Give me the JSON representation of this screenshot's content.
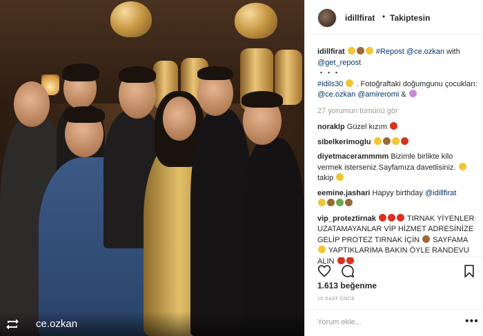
{
  "photo": {
    "repost_user": "ce.ozkan",
    "alt": "Group photo at a birthday party with gold balloons"
  },
  "header": {
    "username": "idillfirat",
    "separator": "•",
    "follow_label": "Takiptesin"
  },
  "caption": {
    "user": "idillfirat",
    "text_1": "#Repost",
    "mention_1": "@ce.ozkan",
    "text_2": "with",
    "mention_2": "@get_repost",
    "dots": "・・・",
    "hashtag": "#idils30",
    "text_3": ". Fotoğraftaki doğumgunu çocukları:",
    "mention_3": "@ce.ozkan",
    "mention_4": "@amireromi",
    "amp": "&"
  },
  "more_comments_label": "27 yorumun tümünü gör",
  "comments": [
    {
      "user": "noraklp",
      "text": "Güzel kızım"
    },
    {
      "user": "sibelkerimoglu",
      "text": ""
    },
    {
      "user": "diyetmacerammmm",
      "text": "Bizimle birlikte kilo vermek isterseniz.Sayfamıza davetlisiniz.",
      "tail": "takip"
    },
    {
      "user": "eemine.jashari",
      "text": "Hapyy birthday",
      "mention": "@idillfirat"
    },
    {
      "user": "vip_proteztirnak",
      "text": "TIRNAK YİYENLER UZATAMAYANLAR VİP HİZMET ADRESİNİZE GELİP PROTEZ TIRNAK İÇİN",
      "text_2": "SAYFAMA",
      "text_3": "YAPTIKLARIMA BAKIN ÖYLE RANDEVU ALIN"
    }
  ],
  "likes_label": "1.613 beğenme",
  "time_label": "15 SAAT ÖNCE",
  "add_comment": {
    "placeholder": "Yorum ekle...",
    "more": "•••"
  },
  "icons": {
    "like": "heart-icon",
    "comment": "comment-icon",
    "save": "bookmark-icon",
    "repost": "repost-icon"
  }
}
